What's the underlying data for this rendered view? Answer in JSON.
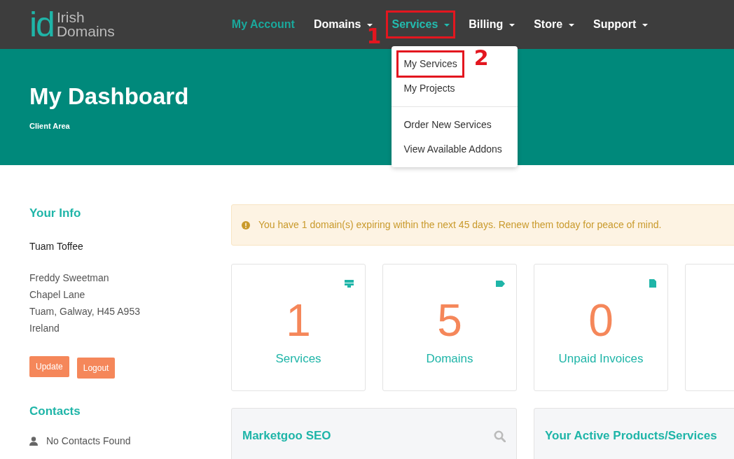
{
  "logo": {
    "mark": "id",
    "line1": "Irish",
    "line2": "Domains"
  },
  "nav": [
    {
      "label": "My Account",
      "selected": true,
      "expanded": false,
      "caret": false
    },
    {
      "label": "Domains",
      "selected": false,
      "expanded": false,
      "caret": true
    },
    {
      "label": "Services",
      "selected": false,
      "expanded": true,
      "caret": true
    },
    {
      "label": "Billing",
      "selected": false,
      "expanded": false,
      "caret": true
    },
    {
      "label": "Store",
      "selected": false,
      "expanded": false,
      "caret": true
    },
    {
      "label": "Support",
      "selected": false,
      "expanded": false,
      "caret": true
    }
  ],
  "dropdown": {
    "sections": [
      [
        "My Services",
        "My Projects"
      ],
      [
        "Order New Services",
        "View Available Addons"
      ]
    ]
  },
  "annotations": [
    {
      "number": "1"
    },
    {
      "number": "2"
    }
  ],
  "hero": {
    "title": "My Dashboard",
    "subtitle": "Client Area"
  },
  "your_info": {
    "heading": "Your Info",
    "company": "Tuam Toffee",
    "address": [
      "Freddy Sweetman",
      "Chapel Lane",
      "Tuam, Galway, H45 A953",
      "Ireland"
    ],
    "buttons": [
      "Update",
      "Logout"
    ]
  },
  "contacts": {
    "heading": "Contacts",
    "empty": "No Contacts Found"
  },
  "alert": "You have 1 domain(s) expiring within the next 45 days. Renew them today for peace of mind.",
  "stats": [
    {
      "kind": "server",
      "value": "1",
      "label": "Services"
    },
    {
      "kind": "tag",
      "value": "5",
      "label": "Domains"
    },
    {
      "kind": "file",
      "value": "0",
      "label": "Unpaid Invoices"
    }
  ],
  "panels": [
    {
      "kind": "search",
      "title": "Marketgoo SEO"
    },
    {
      "kind": "plain",
      "title": "Your Active Products/Services"
    }
  ]
}
